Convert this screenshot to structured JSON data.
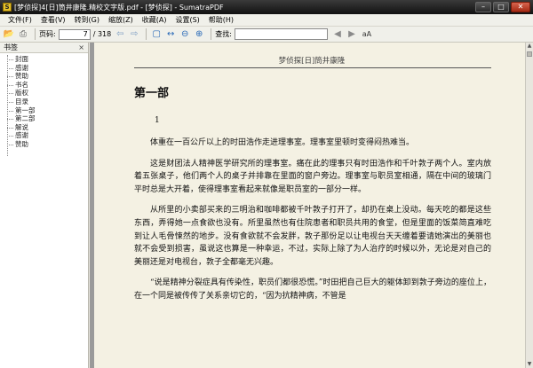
{
  "window": {
    "title": "[梦侦探]4[日]筒井康隆.精校文字版.pdf - [梦侦探] - SumatraPDF",
    "icon_glyph": "S"
  },
  "menu": [
    "文件(F)",
    "查看(V)",
    "转到(G)",
    "缩放(Z)",
    "收藏(A)",
    "设置(S)",
    "帮助(H)"
  ],
  "toolbar": {
    "page_label": "页码:",
    "page_value": "7",
    "page_total": "/ 318",
    "find_label": "查找:",
    "find_value": "",
    "match_case_glyph": "aA"
  },
  "sidebar": {
    "title": "书签",
    "close_glyph": "×",
    "items": [
      "封面",
      "感谢",
      "赞助",
      "书名",
      "版权",
      "目录",
      "第一部",
      "第二部",
      "解说",
      "感谢",
      "赞助"
    ]
  },
  "page": {
    "running_header": "梦侦探[日]筒井康隆",
    "chapter": "第一部",
    "section_number": "1",
    "paragraphs": [
      "体重在一百公斤以上的时田浩作走进理事室。理事室里顿时变得闷热难当。",
      "这是财团法人精神医学研究所的理事室。痛在此的理事只有时田浩作和千叶敦子两个人。室内放着五张桌子，他们两个人的桌子并排靠在里面的窗户旁边。理事室与职员室相通，隔在中间的玻璃门平时总是大开着，使得理事室看起来就像是职员室的一部分一样。",
      "从所里的小卖部买来的三明治和咖啡都被千叶敦子打开了，却扔在桌上没动。每天吃的都是这些东西，弄得她一点食欲也没有。所里虽然也有住院患者和职员共用的食堂，但是里面的饭菜简直难吃到让人毛骨悚然的地步。没有食欲就不会发胖，敦子那份足以让电视台天天缠着要请她演出的美丽也就不会受到损害，虽说这也算是一种幸运，不过，实际上除了为人治疗的时候以外，无论是对自己的美丽还是对电视台，敦子全都毫无兴趣。",
      "“说是精神分裂症具有传染性，职员们都很恐慌。”时田把自己巨大的躯体卸到敦子旁边的座位上，在一个同是被传传了关系亲切它的，“因为抗精神病，不管是"
    ]
  }
}
